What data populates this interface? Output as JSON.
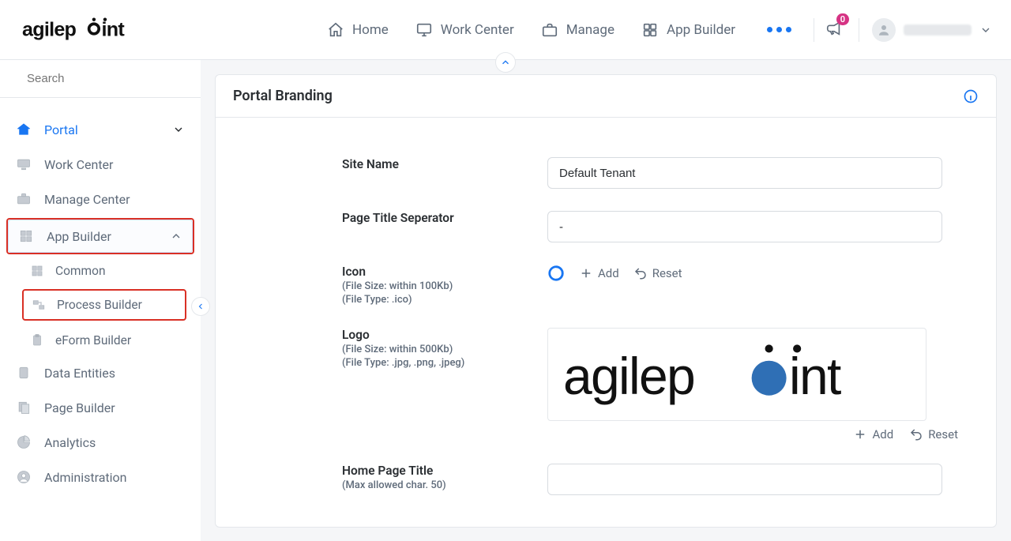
{
  "brand": "agilepoint",
  "nav": {
    "home": "Home",
    "work_center": "Work Center",
    "manage": "Manage",
    "app_builder": "App Builder"
  },
  "notifications": {
    "count": "0"
  },
  "search": {
    "placeholder": "Search"
  },
  "sidebar": {
    "portal": "Portal",
    "work_center": "Work Center",
    "manage_center": "Manage Center",
    "app_builder": "App Builder",
    "common": "Common",
    "process_builder": "Process Builder",
    "eform_builder": "eForm Builder",
    "data_entities": "Data Entities",
    "page_builder": "Page Builder",
    "analytics": "Analytics",
    "administration": "Administration"
  },
  "page": {
    "title": "Portal Branding",
    "site_name": {
      "label": "Site Name",
      "value": "Default Tenant"
    },
    "separator": {
      "label": "Page Title Seperator",
      "value": "-"
    },
    "icon": {
      "label": "Icon",
      "hint1": "(File Size: within 100Kb)",
      "hint2": "(File Type: .ico)"
    },
    "logo": {
      "label": "Logo",
      "hint1": "(File Size: within 500Kb)",
      "hint2": "(File Type: .jpg, .png, .jpeg)"
    },
    "home_page_title": {
      "label": "Home Page Title",
      "hint": "(Max allowed char. 50)",
      "value": ""
    },
    "actions": {
      "add": "Add",
      "reset": "Reset"
    }
  }
}
